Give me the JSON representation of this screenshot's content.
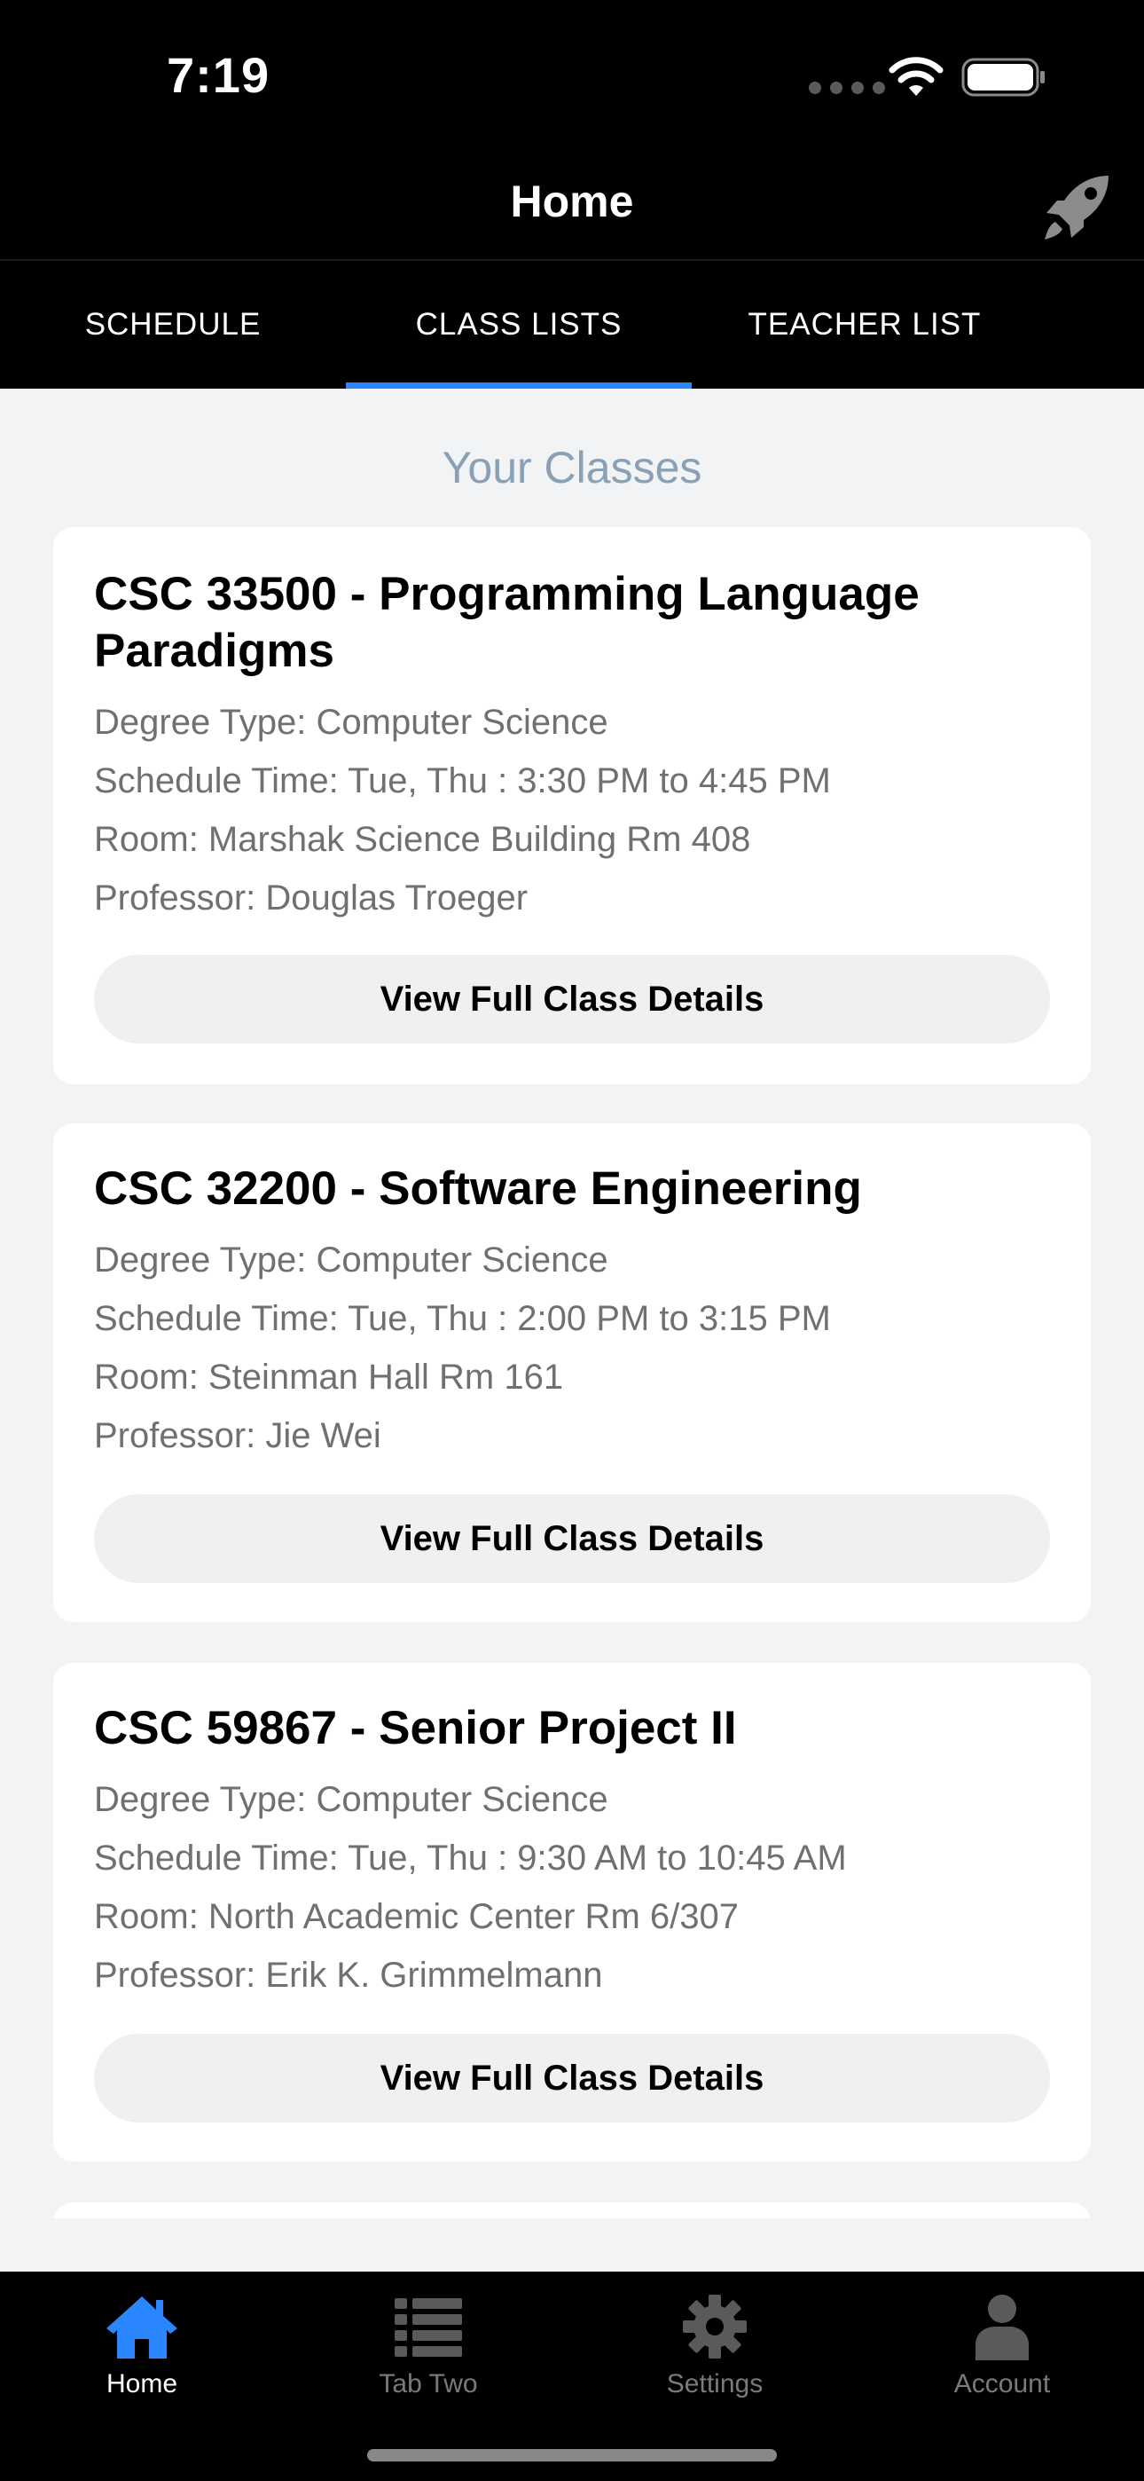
{
  "status_bar": {
    "time": "7:19"
  },
  "header": {
    "title": "Home"
  },
  "top_tabs": [
    {
      "label": "SCHEDULE",
      "active": false
    },
    {
      "label": "CLASS LISTS",
      "active": true
    },
    {
      "label": "TEACHER LIST",
      "active": false
    }
  ],
  "section_title": "Your Classes",
  "classes": [
    {
      "title": "CSC 33500 - Programming Language Paradigms",
      "degree": "Degree Type: Computer Science",
      "schedule": "Schedule Time: Tue, Thu : 3:30 PM to 4:45 PM",
      "room": "Room: Marshak Science Building Rm 408",
      "professor": "Professor: Douglas Troeger",
      "button": "View Full Class Details"
    },
    {
      "title": "CSC 32200 - Software Engineering",
      "degree": "Degree Type: Computer Science",
      "schedule": "Schedule Time: Tue, Thu : 2:00 PM to 3:15 PM",
      "room": "Room: Steinman Hall Rm 161",
      "professor": "Professor: Jie Wei",
      "button": "View Full Class Details"
    },
    {
      "title": "CSC 59867 - Senior Project II",
      "degree": "Degree Type: Computer Science",
      "schedule": "Schedule Time: Tue, Thu : 9:30 AM to 10:45 AM",
      "room": "Room: North Academic Center Rm 6/307",
      "professor": "Professor: Erik K. Grimmelmann",
      "button": "View Full Class Details"
    }
  ],
  "bottom_tabs": [
    {
      "label": "Home",
      "icon": "home-icon",
      "active": true
    },
    {
      "label": "Tab Two",
      "icon": "list-icon",
      "active": false
    },
    {
      "label": "Settings",
      "icon": "gear-icon",
      "active": false
    },
    {
      "label": "Account",
      "icon": "person-icon",
      "active": false
    }
  ],
  "colors": {
    "accent": "#2a86ff",
    "section_title": "#8aa0b4",
    "secondary_text": "#707070",
    "background": "#f2f3f5",
    "bar_background": "#000000"
  }
}
